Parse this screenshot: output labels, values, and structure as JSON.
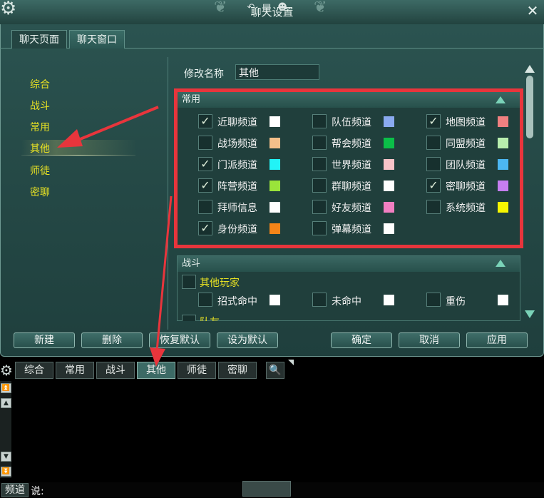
{
  "window": {
    "title": "聊天设置"
  },
  "tabs": [
    {
      "label": "聊天页面",
      "active": false
    },
    {
      "label": "聊天窗口",
      "active": true
    }
  ],
  "sidebar": {
    "items": [
      {
        "label": "综合",
        "selected": false
      },
      {
        "label": "战斗",
        "selected": false
      },
      {
        "label": "常用",
        "selected": false
      },
      {
        "label": "其他",
        "selected": true
      },
      {
        "label": "师徒",
        "selected": false
      },
      {
        "label": "密聊",
        "selected": false
      }
    ]
  },
  "rename": {
    "label": "修改名称",
    "value": "其他"
  },
  "group_common": {
    "title": "常用",
    "rows": [
      [
        {
          "label": "近聊频道",
          "checked": true,
          "color": "#ffffff"
        },
        {
          "label": "队伍频道",
          "checked": false,
          "color": "#8aaaf0"
        },
        {
          "label": "地图频道",
          "checked": true,
          "color": "#f08080"
        }
      ],
      [
        {
          "label": "战场频道",
          "checked": false,
          "color": "#f5c08a"
        },
        {
          "label": "帮会频道",
          "checked": false,
          "color": "#0bbf48"
        },
        {
          "label": "同盟频道",
          "checked": false,
          "color": "#b8eeae"
        }
      ],
      [
        {
          "label": "门派频道",
          "checked": true,
          "color": "#22f3f6"
        },
        {
          "label": "世界频道",
          "checked": false,
          "color": "#f8c4c8"
        },
        {
          "label": "团队频道",
          "checked": false,
          "color": "#4cb7f2"
        }
      ],
      [
        {
          "label": "阵营频道",
          "checked": true,
          "color": "#9ae43a"
        },
        {
          "label": "群聊频道",
          "checked": false,
          "color": "#ffffff"
        },
        {
          "label": "密聊频道",
          "checked": true,
          "color": "#c67ef0"
        }
      ],
      [
        {
          "label": "拜师信息",
          "checked": false,
          "color": "#ffffff"
        },
        {
          "label": "好友频道",
          "checked": false,
          "color": "#f27fc2"
        },
        {
          "label": "系统频道",
          "checked": false,
          "color": "#f6f600"
        }
      ],
      [
        {
          "label": "身份频道",
          "checked": true,
          "color": "#f58418"
        },
        {
          "label": "弹幕频道",
          "checked": false,
          "color": "#ffffff"
        }
      ]
    ]
  },
  "group_battle": {
    "title": "战斗",
    "sub1": "其他玩家",
    "items": [
      {
        "label": "招式命中",
        "checked": false,
        "color": "#ffffff"
      },
      {
        "label": "未命中",
        "checked": false,
        "color": "#ffffff"
      },
      {
        "label": "重伤",
        "checked": false,
        "color": "#ffffff"
      }
    ],
    "sub2": "队友"
  },
  "buttons": {
    "new": "新建",
    "delete": "删除",
    "restore": "恢复默认",
    "set_default": "设为默认",
    "ok": "确定",
    "cancel": "取消",
    "apply": "应用"
  },
  "chat": {
    "tabs": [
      {
        "label": "综合",
        "active": false
      },
      {
        "label": "常用",
        "active": false
      },
      {
        "label": "战斗",
        "active": false
      },
      {
        "label": "其他",
        "active": true
      },
      {
        "label": "师徒",
        "active": false
      },
      {
        "label": "密聊",
        "active": false
      }
    ],
    "channel_button": "频道",
    "say_label": "说:"
  },
  "icons": {
    "settings": "gear-icon",
    "close": "close-icon",
    "search": "search-icon",
    "undo": "undo-icon",
    "message": "message-icon",
    "emoji": "emoji-icon"
  },
  "colors": {
    "highlight_box": "#e8353c",
    "sidebar_text": "#e6e024"
  }
}
